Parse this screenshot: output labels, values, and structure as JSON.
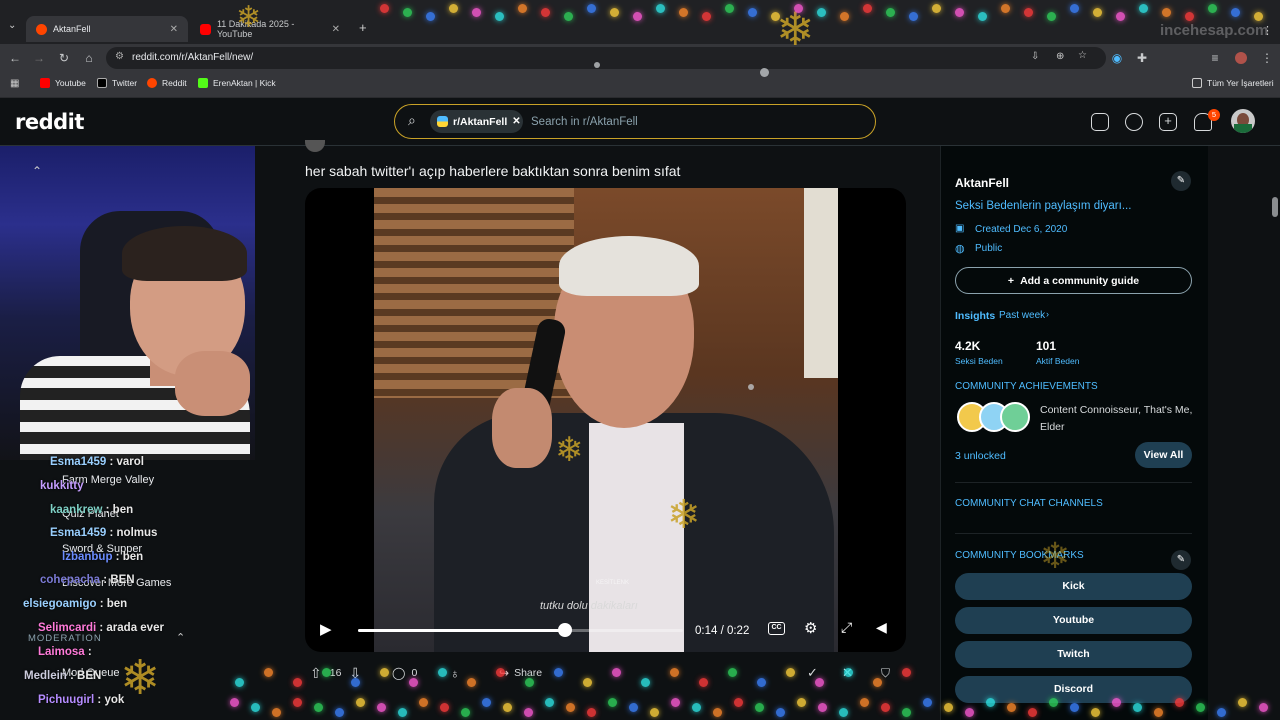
{
  "browser": {
    "tabs": [
      {
        "title": "AktanFell",
        "active": true
      },
      {
        "title": "11 Dakikada 2025 - YouTube",
        "active": false
      }
    ],
    "new_tab": "+",
    "url": "reddit.com/r/AktanFell/new/",
    "bookmarks": [
      "Youtube",
      "Twitter",
      "Reddit",
      "ErenAktan | Kick"
    ],
    "all_bookmarks": "Tüm Yer İşaretleri",
    "watermark": "incehesap.com"
  },
  "reddit": {
    "logo": "reddit",
    "search_chip": "r/AktanFell",
    "search_placeholder": "Search in r/AktanFell",
    "notif_count": "5"
  },
  "post": {
    "title": "her sabah twitter'ı açıp haberlere baktıktan sonra benim sıfat",
    "subtitle_caption": "tutku dolu dakikaları",
    "video_watermark": "KESİTLENK",
    "time": "0:14 / 0:22",
    "progress": 0.636,
    "upvotes": "16",
    "comments": "0",
    "share": "Share"
  },
  "sidebar": {
    "name": "AktanFell",
    "description": "Seksi Bedenlerin paylaşım diyarı...",
    "created": "Created Dec 6, 2020",
    "visibility": "Public",
    "add_guide": "Add a community guide",
    "insights": "Insights",
    "period": "Past week",
    "stat1_value": "4.2K",
    "stat1_label": "Seksi Beden",
    "stat2_value": "101",
    "stat2_label": "Aktif Beden",
    "achievements_title": "COMMUNITY ACHIEVEMENTS",
    "achievements_text": "Content Connoisseur, That's Me, Elder",
    "unlocked": "3 unlocked",
    "view_all": "View All",
    "chat_channels": "COMMUNITY CHAT CHANNELS",
    "bookmarks_title": "COMMUNITY BOOKMARKS",
    "bookmark_buttons": [
      "Kick",
      "Youtube",
      "Twitch",
      "Discord"
    ]
  },
  "chat": [
    {
      "user": "Esma1459",
      "msg": "varol"
    },
    {
      "user": "kukkitty",
      "msg": ""
    },
    {
      "user": "kaankrew",
      "msg": "ben"
    },
    {
      "user": "Esma1459",
      "msg": "nolmus"
    },
    {
      "user": "lzbanbup",
      "msg": "ben"
    },
    {
      "user": "cohepacha",
      "msg": "BEN"
    },
    {
      "user": "elsiegoamigo",
      "msg": "ben"
    },
    {
      "user": "Selimcardi",
      "msg": "arada ever"
    },
    {
      "user": "Laimosa",
      "msg": ""
    },
    {
      "user": "Medlein",
      "msg": "BEN"
    },
    {
      "user": "Pichuugirl",
      "msg": "yok"
    }
  ],
  "left_menu": {
    "games": [
      "Farm Merge Valley",
      "Quiz Planet",
      "Sword & Supper",
      "Discover More Games"
    ],
    "moderation": "MODERATION",
    "mod_queue": "Mod Queue"
  }
}
